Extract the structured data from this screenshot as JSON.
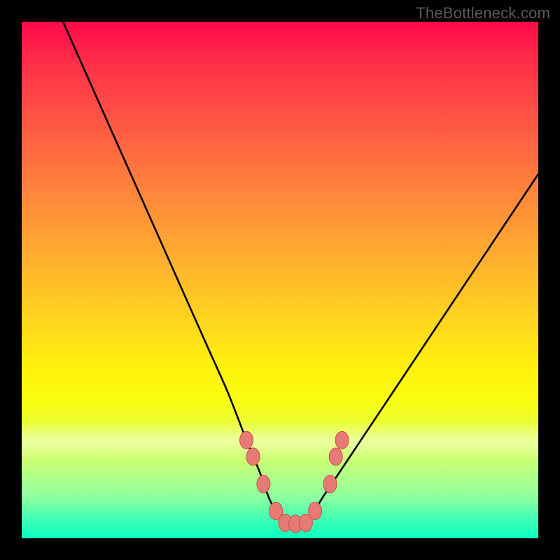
{
  "watermark": "TheBottleneck.com",
  "colors": {
    "frame": "#000000",
    "curve_stroke": "#000000",
    "marker_fill": "#e77a74",
    "marker_stroke": "#c94f48"
  },
  "chart_data": {
    "type": "line",
    "title": "",
    "xlabel": "",
    "ylabel": "",
    "xlim": [
      0,
      100
    ],
    "ylim": [
      0,
      100
    ],
    "grid": false,
    "legend": false,
    "series": [
      {
        "name": "curve",
        "x": [
          8,
          12,
          16,
          20,
          24,
          28,
          32,
          36,
          40,
          43.5,
          46,
          48,
          50,
          52,
          54,
          56,
          58,
          62,
          66,
          70,
          74,
          78,
          82,
          86,
          90,
          94,
          98,
          100
        ],
        "y": [
          100,
          91,
          82,
          73,
          64,
          55,
          46,
          37,
          28,
          19,
          13,
          7.5,
          4,
          2.8,
          2.8,
          4,
          7.5,
          13.5,
          19.5,
          25.5,
          31.5,
          37.5,
          43.5,
          49.5,
          55.5,
          61.5,
          67.5,
          70.5
        ]
      }
    ],
    "markers": [
      {
        "x": 43.5,
        "y": 19.0
      },
      {
        "x": 44.8,
        "y": 15.8
      },
      {
        "x": 46.8,
        "y": 10.5
      },
      {
        "x": 49.2,
        "y": 5.3
      },
      {
        "x": 51.0,
        "y": 3.0
      },
      {
        "x": 53.0,
        "y": 2.8
      },
      {
        "x": 55.0,
        "y": 3.0
      },
      {
        "x": 56.8,
        "y": 5.3
      },
      {
        "x": 59.7,
        "y": 10.5
      },
      {
        "x": 60.8,
        "y": 15.8
      },
      {
        "x": 62.0,
        "y": 19.0
      }
    ]
  }
}
